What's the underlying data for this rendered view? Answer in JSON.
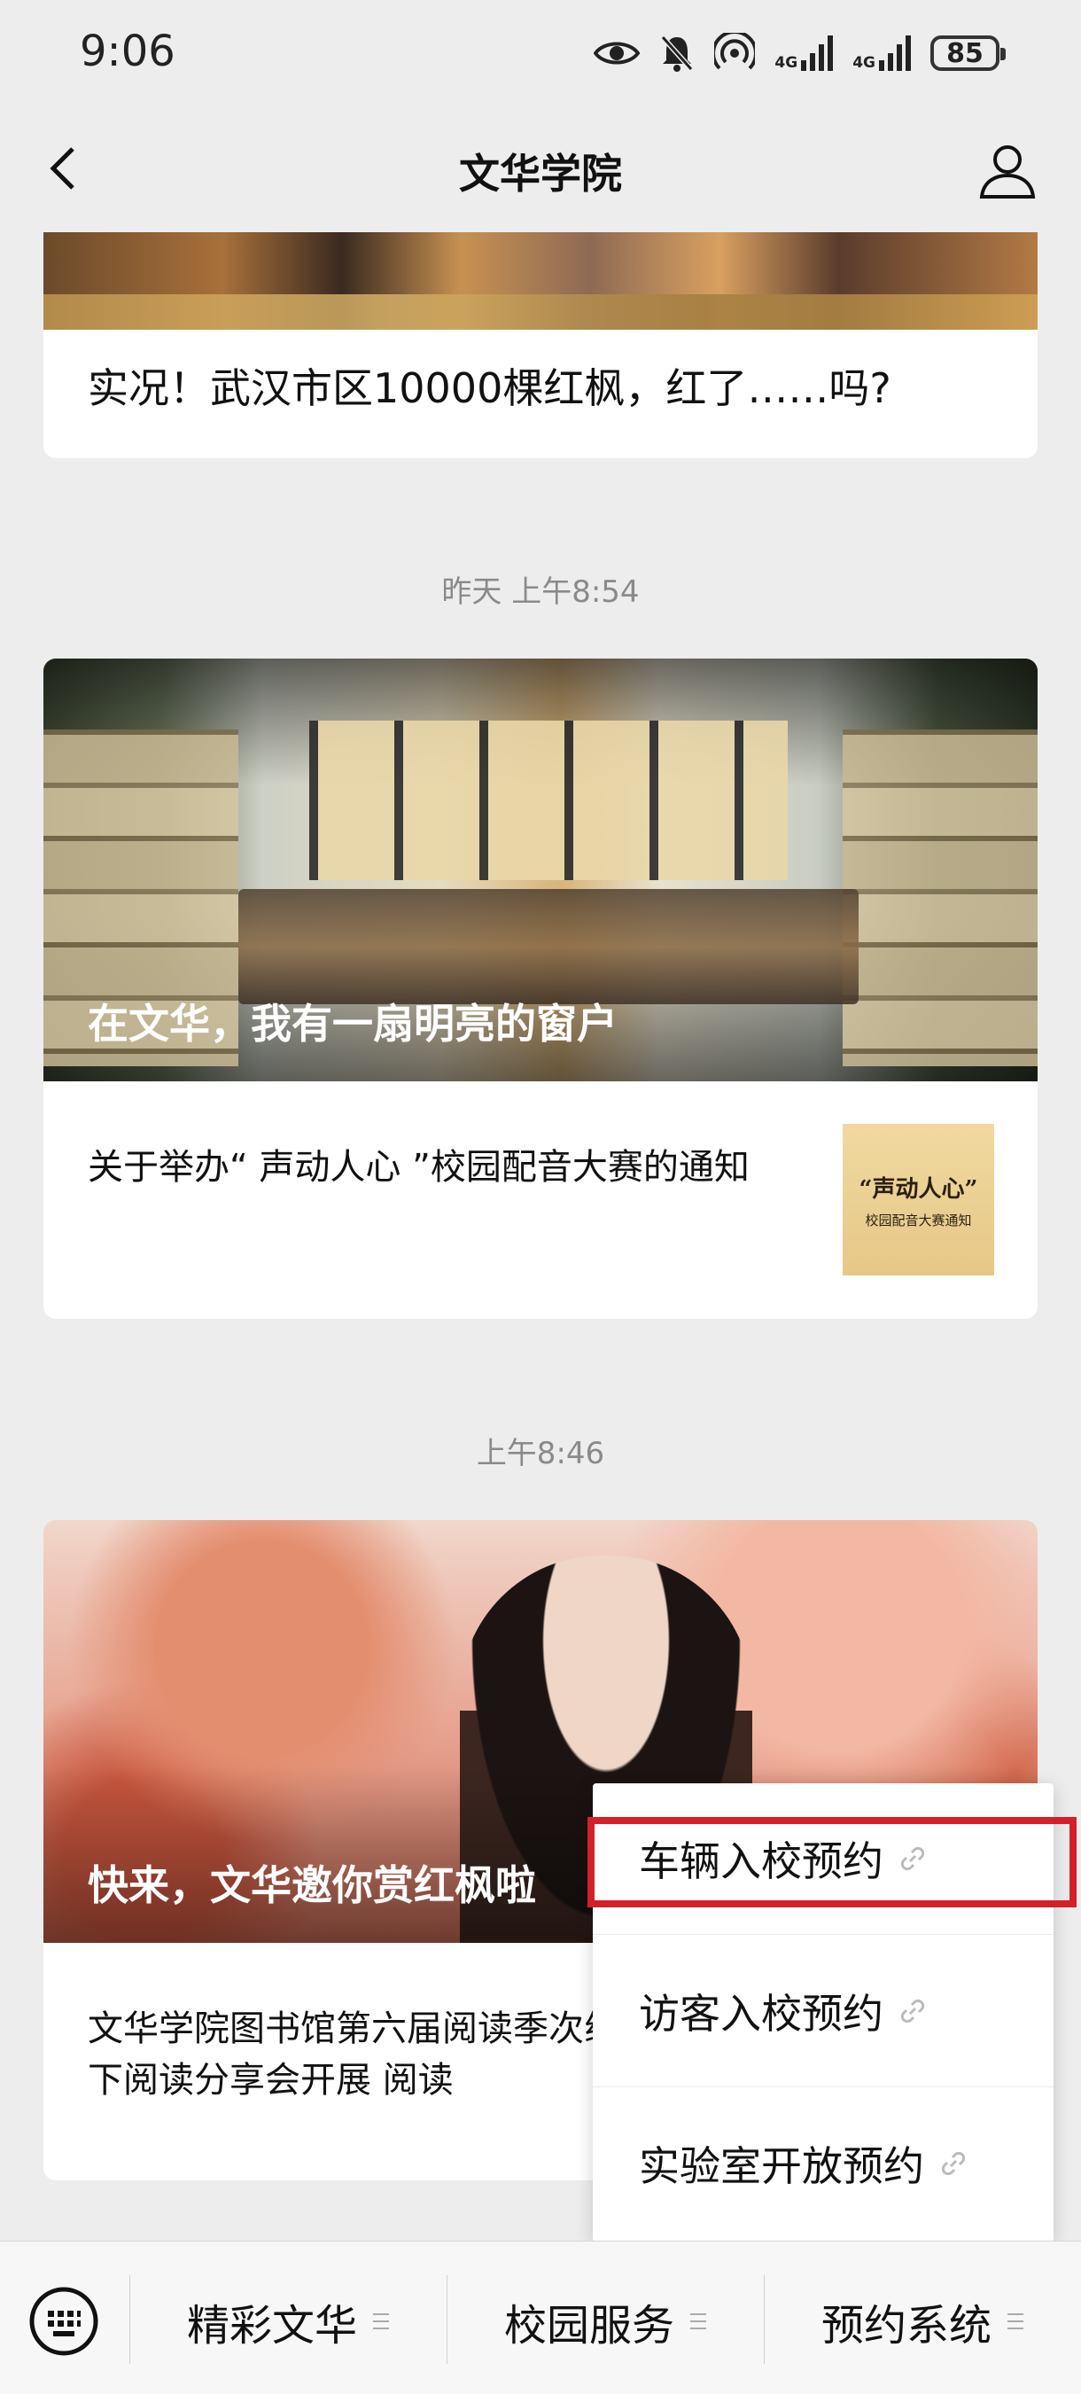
{
  "status_bar": {
    "time": "9:06",
    "network_1": "4G",
    "network_2": "4G",
    "battery": "85"
  },
  "nav": {
    "title": "文华学院"
  },
  "feed": {
    "card1": {
      "headline": "实况！武汉市区10000棵红枫，红了……吗?"
    },
    "timestamp1": "昨天 上午8:54",
    "card2": {
      "hero_caption": "在文华，我有一扇明亮的窗户",
      "item_text": "关于举办“ 声动人心 ”校园配音大赛的通知",
      "thumb_title": "“声动人心”",
      "thumb_subtitle": "校园配音大赛通知"
    },
    "timestamp2": "上午8:46",
    "card3": {
      "hero_caption": "快来，文华邀你赏红枫啦",
      "item_text": "文华学院图书馆第六届阅读季次线下阅读分享会开展 阅读"
    }
  },
  "popup_menu": {
    "items": [
      {
        "label": "车辆入校预约"
      },
      {
        "label": "访客入校预约"
      },
      {
        "label": "实验室开放预约"
      }
    ],
    "highlight_color": "#d3202a"
  },
  "bottom_menu": {
    "items": [
      {
        "label": "精彩文华"
      },
      {
        "label": "校园服务"
      },
      {
        "label": "预约系统"
      }
    ]
  }
}
